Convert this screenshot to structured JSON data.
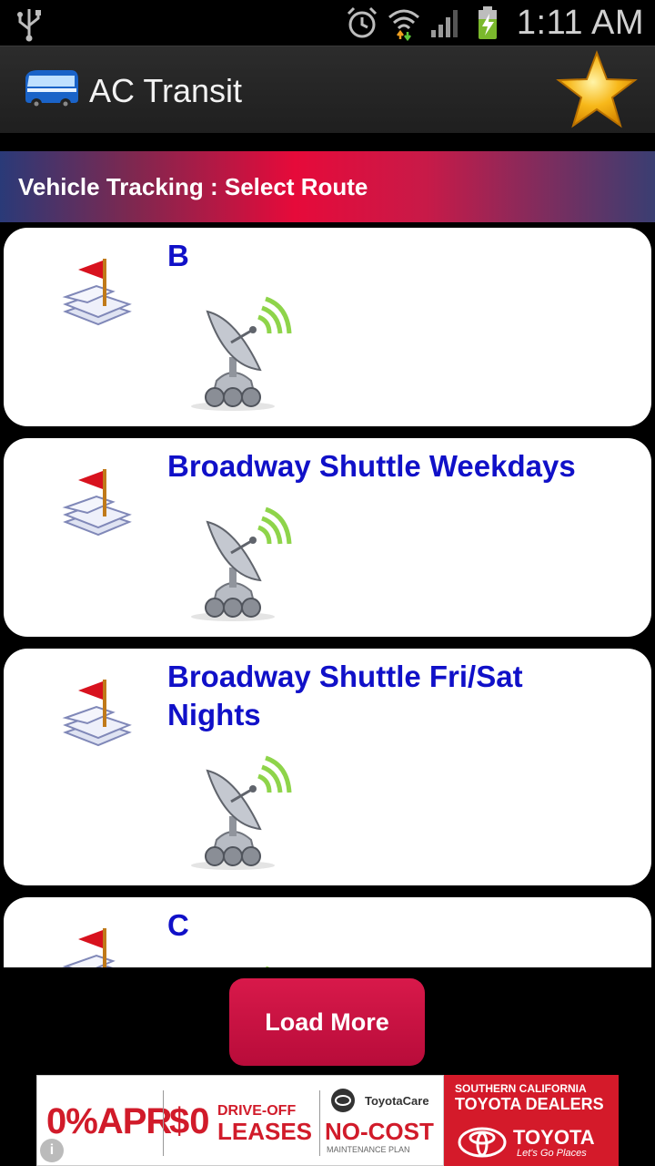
{
  "status_bar": {
    "time": "1:11 AM"
  },
  "app": {
    "title": "AC Transit"
  },
  "section": {
    "title": "Vehicle Tracking : Select Route"
  },
  "routes": [
    {
      "name": "B"
    },
    {
      "name": "Broadway Shuttle Weekdays"
    },
    {
      "name": "Broadway Shuttle Fri/Sat Nights"
    },
    {
      "name": "C"
    }
  ],
  "load_more": {
    "label": "Load More"
  },
  "ad": {
    "apr": "0%APR",
    "dollar": "$0",
    "lease_line1": "DRIVE-OFF",
    "lease_line2": "LEASES",
    "care": "ToyotaCare",
    "no_cost": "NO-COST",
    "plan": "MAINTENANCE PLAN",
    "region": "SOUTHERN CALIFORNIA",
    "dealers": "TOYOTA DEALERS",
    "brand": "TOYOTA",
    "slogan": "Let's Go Places",
    "info": "i"
  },
  "colors": {
    "route_text": "#1010c8",
    "header_red": "#e60a3a",
    "button_red": "#c8123f"
  }
}
